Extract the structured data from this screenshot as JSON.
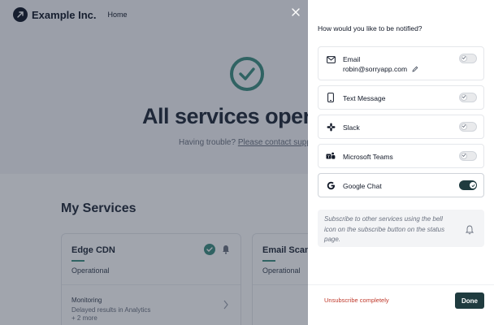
{
  "colors": {
    "accent": "#3d8d80",
    "primary_dark": "#1f3b3f",
    "danger": "#c0392b",
    "overlay": "rgba(30,41,59,0.42)"
  },
  "background": {
    "brand": "Example Inc.",
    "nav_home": "Home",
    "hero_title": "All services operat",
    "hero_sub_prefix": "Having trouble? ",
    "hero_sub_link": "Please contact suppo",
    "services_heading": "My Services",
    "cards": [
      {
        "name": "Edge CDN",
        "status": "Operational",
        "monitoring": "Monitoring",
        "detail": "Delayed results in Analytics",
        "more": "+ 2 more"
      },
      {
        "name": "Email Scann",
        "status": "Operational"
      }
    ]
  },
  "drawer": {
    "title": "How would you like to be notified?",
    "options": [
      {
        "label": "Email",
        "value": "robin@sorryapp.com",
        "icon": "mail-icon",
        "enabled": false
      },
      {
        "label": "Text Message",
        "icon": "phone-icon",
        "enabled": false
      },
      {
        "label": "Slack",
        "icon": "slack-icon",
        "enabled": false
      },
      {
        "label": "Microsoft Teams",
        "icon": "teams-icon",
        "enabled": false
      },
      {
        "label": "Google Chat",
        "icon": "google-icon",
        "enabled": true
      }
    ],
    "info": "Subscribe to other services using the bell icon on the subscribe button on the status page.",
    "unsubscribe": "Unsubscribe completely",
    "done": "Done"
  }
}
